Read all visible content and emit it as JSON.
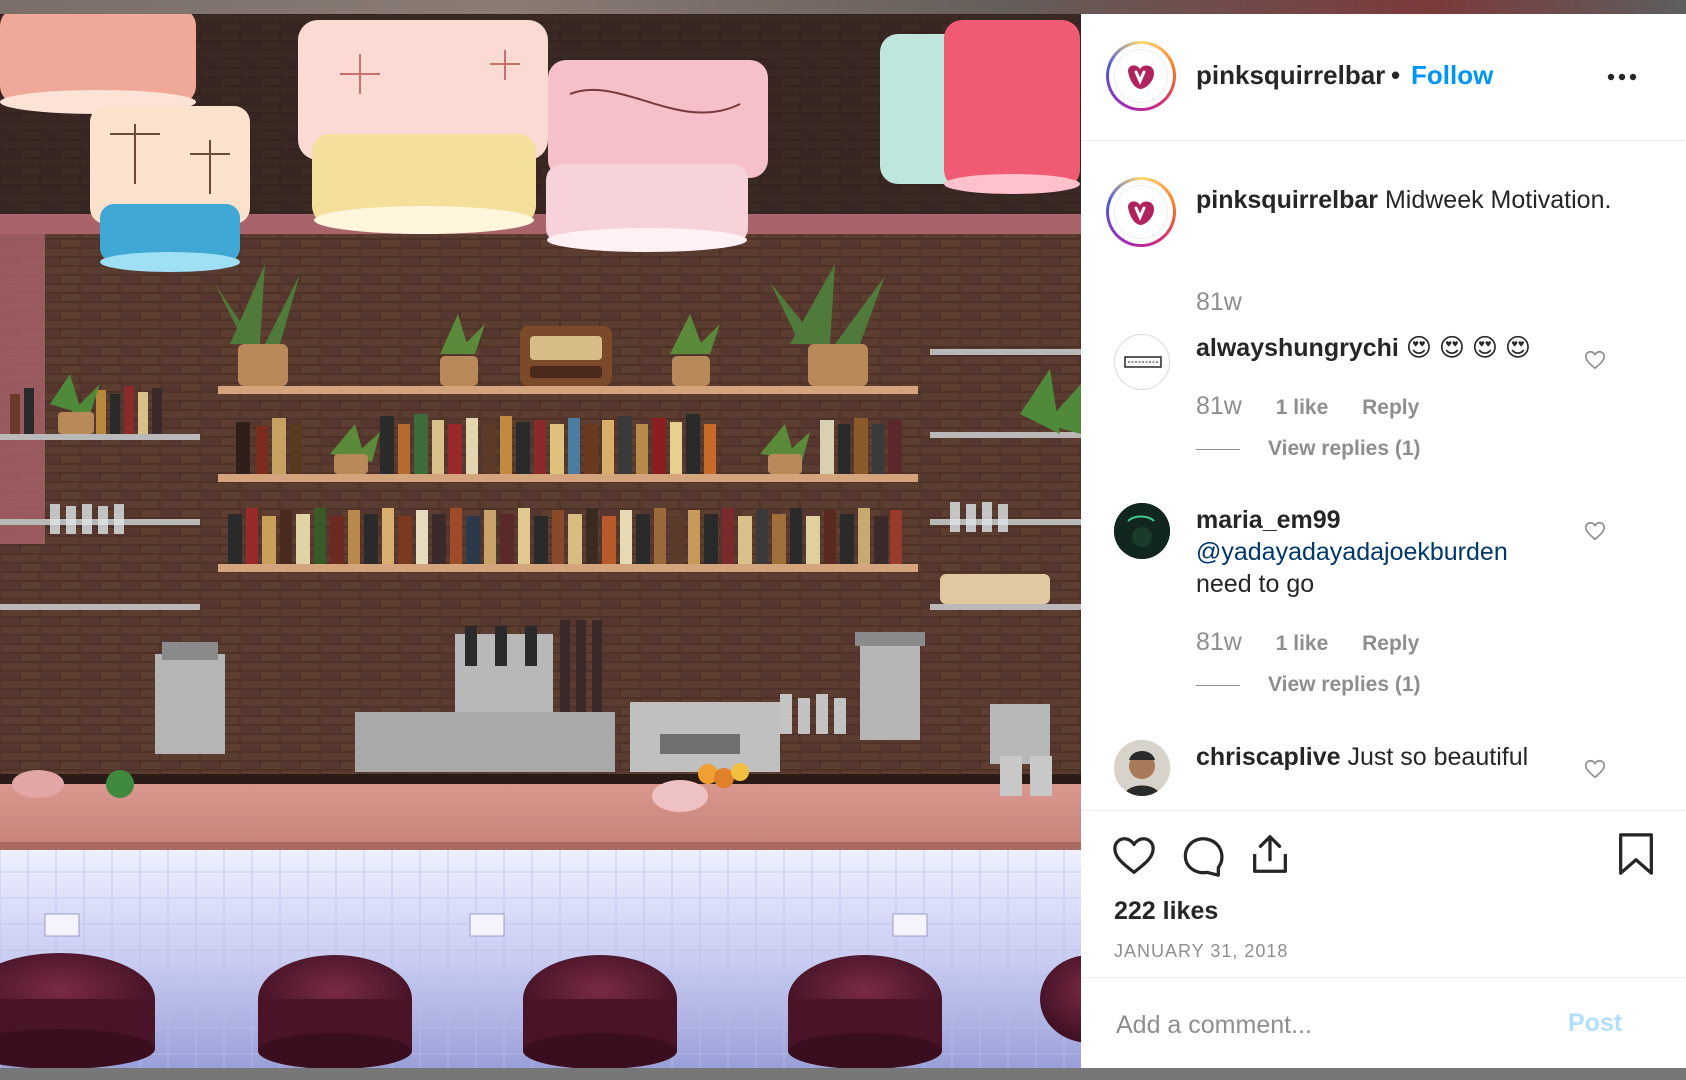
{
  "post": {
    "username": "pinksquirrelbar",
    "separator": "•",
    "follow_label": "Follow",
    "caption_text": "Midweek Motivation.",
    "caption_time": "81w",
    "likes": "222 likes",
    "date": "JANUARY 31, 2018"
  },
  "comments": [
    {
      "username": "alwayshungrychi",
      "emoji": "😍 😍 😍 😍",
      "time": "81w",
      "likes": "1 like",
      "reply": "Reply",
      "view_replies": "View replies (1)"
    },
    {
      "username": "maria_em99",
      "mention": "@yadayadayadajoekburden",
      "text": "need to go",
      "time": "81w",
      "likes": "1 like",
      "reply": "Reply",
      "view_replies": "View replies (1)"
    },
    {
      "username": "chriscaplive",
      "text": "Just so beautiful"
    }
  ],
  "composer": {
    "placeholder": "Add a comment...",
    "post_label": "Post"
  },
  "colors": {
    "link_blue": "#0095f6",
    "mention_blue": "#00376b",
    "secondary_text": "#8e8e8e",
    "post_disabled": "#b2dffc",
    "brand_magenta": "#b0235f"
  },
  "icons": {
    "more": "more-horizontal-icon",
    "like": "heart-icon",
    "comment": "comment-bubble-icon",
    "share": "share-icon",
    "save": "bookmark-icon"
  }
}
